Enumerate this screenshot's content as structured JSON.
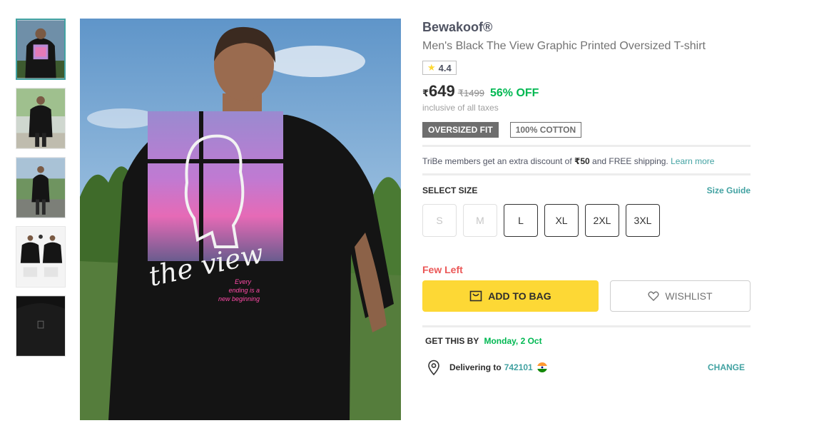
{
  "product": {
    "brand": "Bewakoof®",
    "title": "Men's Black The View Graphic Printed Oversized T-shirt",
    "rating": "4.4",
    "currency_symbol": "₹",
    "price": "649",
    "mrp": "₹1499",
    "discount": "56% OFF",
    "taxes_note": "inclusive of all taxes",
    "tags": [
      "OVERSIZED FIT",
      "100% COTTON"
    ]
  },
  "tribe": {
    "text_before": "TriBe members get an extra discount of ",
    "amount": "₹50",
    "text_after": " and FREE shipping. ",
    "link": "Learn more"
  },
  "size": {
    "heading": "SELECT SIZE",
    "guide": "Size Guide",
    "options": [
      {
        "label": "S",
        "available": false
      },
      {
        "label": "M",
        "available": false
      },
      {
        "label": "L",
        "available": true
      },
      {
        "label": "XL",
        "available": true
      },
      {
        "label": "2XL",
        "available": true
      },
      {
        "label": "3XL",
        "available": true
      }
    ]
  },
  "stock_note": "Few Left",
  "actions": {
    "add_to_bag": "ADD TO BAG",
    "wishlist": "WISHLIST"
  },
  "delivery": {
    "get_by_label": "GET THIS BY",
    "date": "Monday, 2 Oct",
    "delivering_to": "Delivering to",
    "pincode": "742101",
    "change": "CHANGE"
  },
  "image": {
    "print_text": "the view",
    "caption_lines": [
      "Every",
      "ending is a",
      "new beginning"
    ]
  },
  "colors": {
    "accent_teal": "#42a2a2",
    "discount_green": "#00b852",
    "bag_yellow": "#fdd835",
    "few_left_red": "#eb5757"
  }
}
